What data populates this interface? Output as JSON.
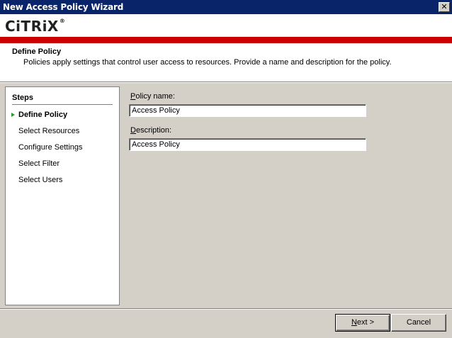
{
  "window": {
    "title": "New Access Policy Wizard"
  },
  "brand": {
    "logo_text": "CiTRiX",
    "reg_mark": "®",
    "accent_color": "#cc0000"
  },
  "header": {
    "title": "Define Policy",
    "description": "Policies apply settings that control user access to resources. Provide a name and description for the policy."
  },
  "steps": {
    "heading": "Steps",
    "items": [
      {
        "label": "Define Policy",
        "active": true
      },
      {
        "label": "Select Resources",
        "active": false
      },
      {
        "label": "Configure Settings",
        "active": false
      },
      {
        "label": "Select Filter",
        "active": false
      },
      {
        "label": "Select Users",
        "active": false
      }
    ]
  },
  "form": {
    "policy_name": {
      "label_access_key": "P",
      "label_rest": "olicy name:",
      "value": "Access Policy"
    },
    "description": {
      "label_access_key": "D",
      "label_rest": "escription:",
      "value": "Access Policy"
    }
  },
  "buttons": {
    "next": {
      "access_key": "N",
      "rest": "ext >"
    },
    "cancel": "Cancel"
  }
}
